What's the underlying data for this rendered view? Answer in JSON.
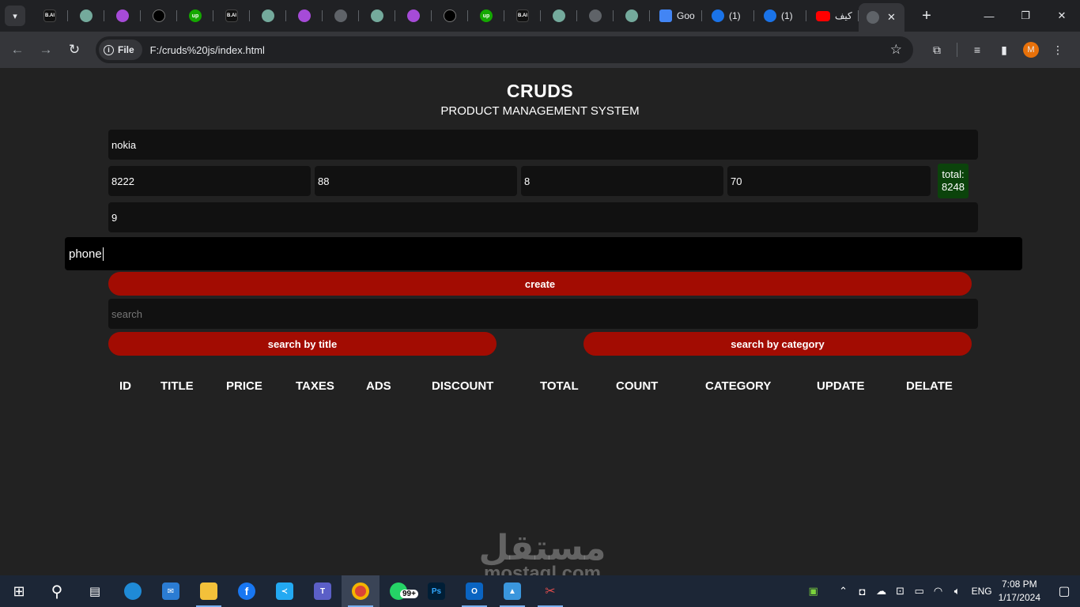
{
  "browser": {
    "tabs": [
      {
        "icon": "bai-icon",
        "label": "B.AI"
      },
      {
        "icon": "chatgpt-icon",
        "label": ""
      },
      {
        "icon": "purple-bot-icon",
        "label": ""
      },
      {
        "icon": "dark-circle-icon",
        "label": ""
      },
      {
        "icon": "upwork-icon",
        "label": "up"
      },
      {
        "icon": "bai-icon",
        "label": "B.AI"
      },
      {
        "icon": "chatgpt-icon",
        "label": ""
      },
      {
        "icon": "purple-bot-icon",
        "label": ""
      },
      {
        "icon": "globe-icon",
        "label": ""
      },
      {
        "icon": "chatgpt-icon",
        "label": ""
      },
      {
        "icon": "purple-bot-icon",
        "label": ""
      },
      {
        "icon": "dark-circle-icon",
        "label": ""
      },
      {
        "icon": "upwork-icon",
        "label": "up"
      },
      {
        "icon": "bai-icon",
        "label": "B.AI"
      },
      {
        "icon": "chatgpt-icon",
        "label": ""
      },
      {
        "icon": "globe-icon",
        "label": ""
      },
      {
        "icon": "chatgpt-icon",
        "label": ""
      }
    ],
    "wide_tabs": [
      {
        "icon": "google-translate-icon",
        "title": "Goo"
      },
      {
        "icon": "blue-notify-icon",
        "title": "(1)"
      },
      {
        "icon": "blue-notify-icon",
        "title": "(1)"
      },
      {
        "icon": "youtube-icon",
        "title": "كيف"
      }
    ],
    "chip_label": "File",
    "url": "F:/cruds%20js/index.html",
    "avatar_letter": "M"
  },
  "app": {
    "title": "CRUDS",
    "subtitle": "PRODUCT MANAGEMENT SYSTEM",
    "title_value": "nokia",
    "price_value": "8222",
    "taxes_value": "88",
    "ads_value": "8",
    "discount_value": "70",
    "total_label": "total:",
    "total_value": "8248",
    "count_value": "9",
    "category_value": "phone",
    "create_label": "create",
    "search_placeholder": "search",
    "search_title_label": "search by title",
    "search_category_label": "search by category",
    "columns": [
      "ID",
      "TITLE",
      "PRICE",
      "TAXES",
      "ADS",
      "DISCOUNT",
      "TOTAL",
      "COUNT",
      "CATEGORY",
      "UPDATE",
      "DELATE"
    ]
  },
  "taskbar": {
    "whatsapp_badge": "99+",
    "language": "ENG",
    "time": "7:08 PM",
    "date": "1/17/2024"
  },
  "watermark": {
    "arabic": "مستقل",
    "latin": "mostaql.com"
  },
  "colors": {
    "page_bg": "#222222",
    "input_bg": "#111111",
    "button_red": "#a20c02",
    "total_green": "#0b430b"
  }
}
